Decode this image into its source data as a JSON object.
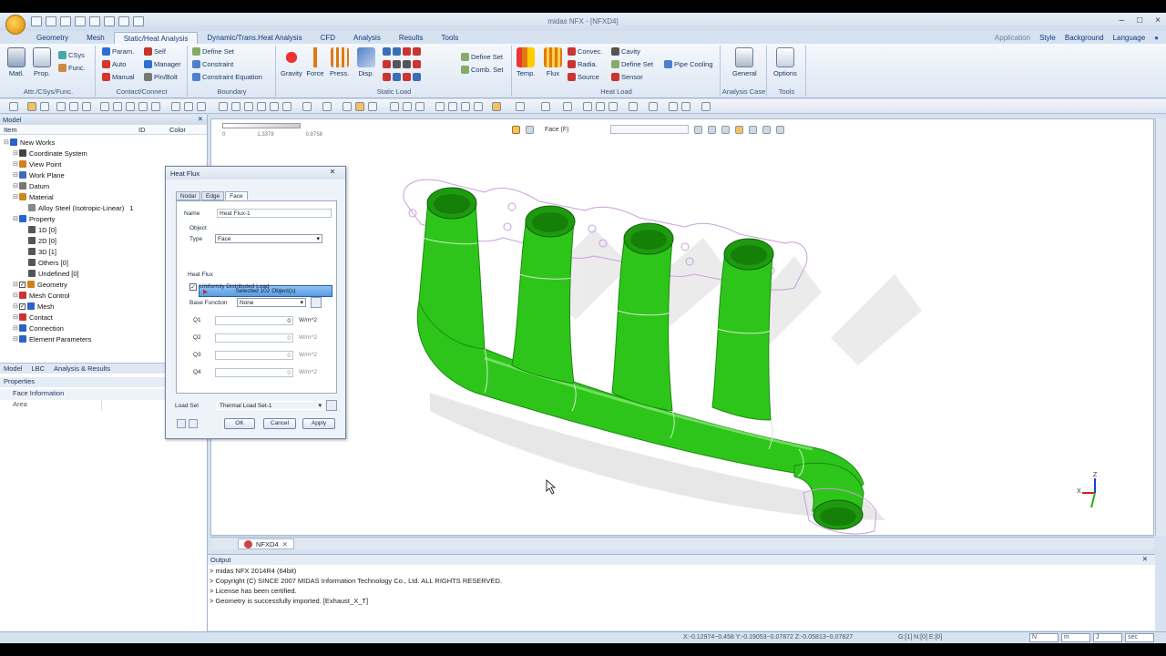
{
  "window": {
    "title": "midas NFX - [NFXD4]",
    "controls": [
      "–",
      "□",
      "×"
    ]
  },
  "tabs": [
    "Geometry",
    "Mesh",
    "Static/Heat Analysis",
    "Dynamic/Trans.Heat Analysis",
    "CFD",
    "Analysis",
    "Results",
    "Tools"
  ],
  "active_tab": "Static/Heat Analysis",
  "menu_right": {
    "application": "Application",
    "style": "Style",
    "background": "Background",
    "language": "Language"
  },
  "ribbon": {
    "attr": {
      "label": "Attr./CSys/Func.",
      "matl": "Matl.",
      "prop": "Prop.",
      "csys": "CSys",
      "func": "Func."
    },
    "contact": {
      "label": "Contact/Connect",
      "param": "Param.",
      "auto": "Auto",
      "manual": "Manual",
      "self": "Self",
      "manager": "Manager",
      "pinbolt": "Pin/Bolt"
    },
    "boundary": {
      "label": "Boundary",
      "define_set": "Define Set",
      "constraint": "Constraint",
      "constraint_eq": "Constraint Equation"
    },
    "static_load": {
      "label": "Static Load",
      "gravity": "Gravity",
      "force": "Force",
      "press": "Press.",
      "disp": "Disp.",
      "define_set": "Define Set",
      "comb_set": "Comb. Set"
    },
    "heat_load": {
      "label": "Heat Load",
      "temp": "Temp.",
      "flux": "Flux",
      "convec": "Convec.",
      "radia": "Radia.",
      "source": "Source",
      "cavity": "Cavity",
      "define_set": "Define Set",
      "sensor": "Sensor",
      "pipe_cooling": "Pipe Cooling"
    },
    "analysis_case": {
      "label": "Analysis Case",
      "general": "General"
    },
    "tools": {
      "label": "Tools",
      "options": "Options"
    }
  },
  "model_panel": {
    "title": "Model",
    "columns": [
      "Item",
      "ID",
      "Color"
    ],
    "tree": [
      {
        "label": "New Works",
        "indent": 0,
        "check": false
      },
      {
        "label": "Coordinate System",
        "indent": 1,
        "check": false
      },
      {
        "label": "View Point",
        "indent": 1,
        "check": false
      },
      {
        "label": "Work Plane",
        "indent": 1,
        "check": false
      },
      {
        "label": "Datum",
        "indent": 1,
        "check": false
      },
      {
        "label": "Material",
        "indent": 1,
        "check": false
      },
      {
        "label": "Alloy Steel (Isotropic-Linear)",
        "indent": 2,
        "check": false,
        "id": "1"
      },
      {
        "label": "Property",
        "indent": 1,
        "check": false
      },
      {
        "label": "1D [0]",
        "indent": 2,
        "check": false
      },
      {
        "label": "2D [0]",
        "indent": 2,
        "check": false
      },
      {
        "label": "3D [1]",
        "indent": 2,
        "check": false
      },
      {
        "label": "Others [0]",
        "indent": 2,
        "check": false
      },
      {
        "label": "Undefined [0]",
        "indent": 2,
        "check": false
      },
      {
        "label": "Geometry",
        "indent": 1,
        "check": true
      },
      {
        "label": "Mesh Control",
        "indent": 1,
        "check": false
      },
      {
        "label": "Mesh",
        "indent": 1,
        "check": true
      },
      {
        "label": "Contact",
        "indent": 1,
        "check": false
      },
      {
        "label": "Connection",
        "indent": 1,
        "check": false
      },
      {
        "label": "Element Parameters",
        "indent": 1,
        "check": false
      }
    ],
    "bottom_tabs": [
      "Model",
      "LBC",
      "Analysis & Results"
    ],
    "properties_title": "Properties",
    "prop_section": "Face Information",
    "prop_row": "Area"
  },
  "viewport": {
    "scale_labels": [
      "0",
      "1.3378",
      "0.8758"
    ],
    "view_label": "Face (F)",
    "doc_tab": "NFXD4"
  },
  "dialog": {
    "title": "Heat Flux",
    "tabs": [
      "Nodal",
      "Edge",
      "Face"
    ],
    "active_tab": "Face",
    "name_label": "Name",
    "name_value": "Heat Flux-1",
    "object_label": "Object",
    "type_label": "Type",
    "type_value": "Face",
    "selected_text": "Selected 102 Object(s)",
    "heat_flux_label": "Heat Flux",
    "uniform_label": "Uniformly Distributed Load",
    "base_function_label": "Base Function",
    "base_function_value": "None",
    "q_rows": [
      {
        "label": "Q1",
        "value": "0",
        "unit": "W/m^2"
      },
      {
        "label": "Q2",
        "value": "0",
        "unit": "W/m^2"
      },
      {
        "label": "Q3",
        "value": "0",
        "unit": "W/m^2"
      },
      {
        "label": "Q4",
        "value": "0",
        "unit": "W/m^2"
      }
    ],
    "load_set_label": "Load Set",
    "load_set_value": "Thermal Load Set-1",
    "ok": "OK",
    "cancel": "Cancel",
    "apply": "Apply"
  },
  "output": {
    "title": "Output",
    "lines": [
      "> midas NFX 2014R4 (64bit)",
      "> Copyright (C) SINCE 2007 MIDAS Information Technology Co., Ltd. ALL RIGHTS RESERVED.",
      "> License has been certified.",
      "> Geometry is successfully imported. [Exhaust_X_T]"
    ]
  },
  "status": {
    "coords": "X:-0.12974~0.458 Y:-0.19053~0.07872 Z:-0.05813~0.07827",
    "counts": "G:[1] N:[0] E:[0]",
    "units": [
      "N",
      "m",
      "J",
      "sec"
    ]
  },
  "triad": {
    "z": "Z",
    "x": "X"
  },
  "colors": {
    "model_green": "#2ec51a",
    "ribbon_bg": "#dde7f3",
    "accent": "#15397a"
  }
}
